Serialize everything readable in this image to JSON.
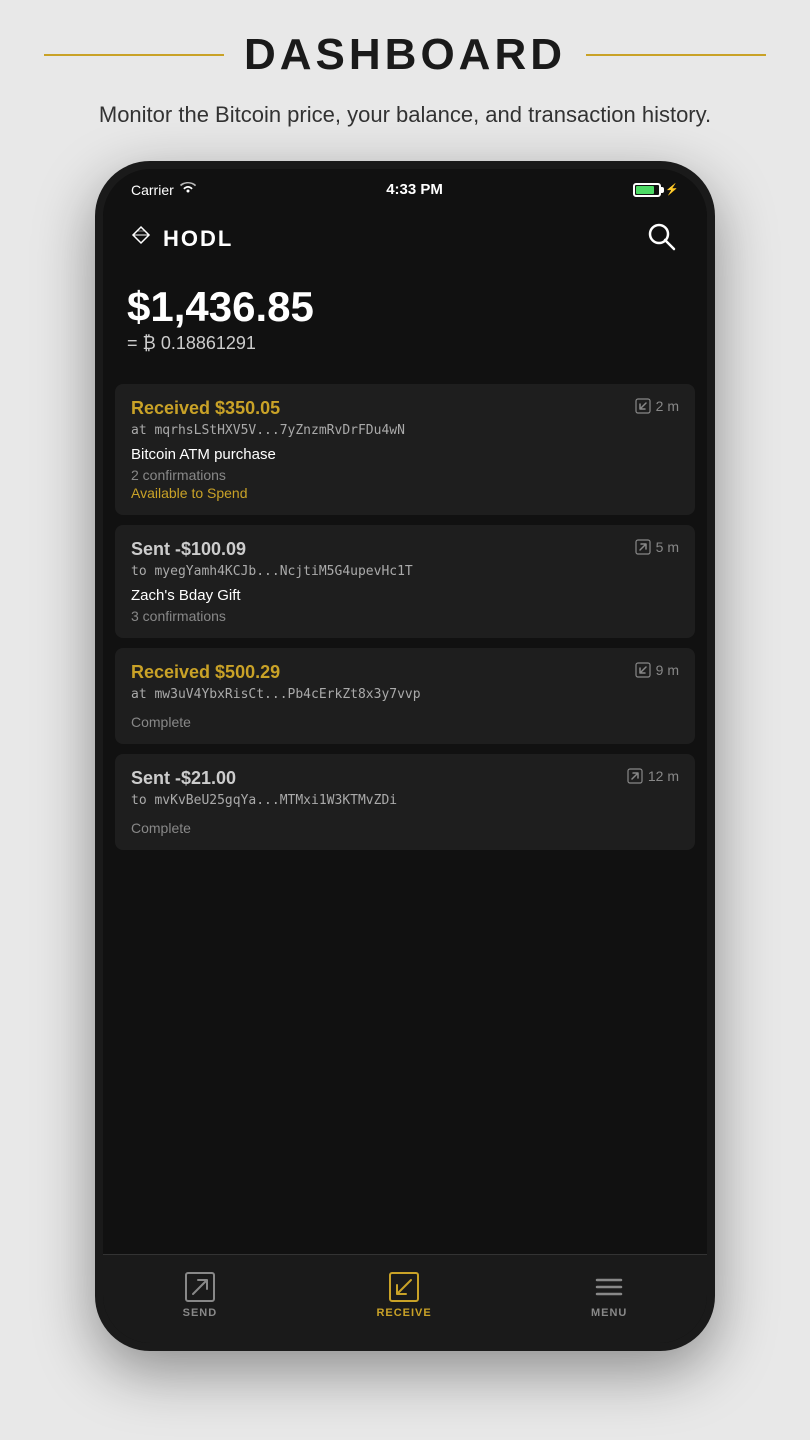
{
  "page": {
    "title": "DASHBOARD",
    "subtitle": "Monitor the Bitcoin price, your balance, and transaction history."
  },
  "status_bar": {
    "carrier": "Carrier",
    "wifi": "wifi",
    "time": "4:33 PM",
    "battery": "80"
  },
  "app": {
    "logo_text": "HODL",
    "balance_usd": "$1,436.85",
    "balance_eq": "= ₿ 0.18861291"
  },
  "transactions": [
    {
      "amount": "Received $350.05",
      "type": "received",
      "address": "at mqrhsLStHXV5V...7yZnzmRvDrFDu4wN",
      "time": "2 m",
      "label": "Bitcoin ATM purchase",
      "confirmations": "2 confirmations",
      "status": "Available to Spend",
      "status_type": "available"
    },
    {
      "amount": "Sent -$100.09",
      "type": "sent",
      "address": "to myegYamh4KCJb...NcjtiM5G4upevHc1T",
      "time": "5 m",
      "label": "Zach's Bday Gift",
      "confirmations": "3 confirmations",
      "status": "",
      "status_type": "none"
    },
    {
      "amount": "Received $500.29",
      "type": "received",
      "address": "at mw3uV4YbxRisCt...Pb4cErkZt8x3y7vvp",
      "time": "9 m",
      "label": "",
      "confirmations": "",
      "status": "Complete",
      "status_type": "complete"
    },
    {
      "amount": "Sent -$21.00",
      "type": "sent",
      "address": "to mvKvBeU25gqYa...MTMxi1W3KTMvZDi",
      "time": "12 m",
      "label": "",
      "confirmations": "",
      "status": "Complete",
      "status_type": "complete"
    }
  ],
  "nav": {
    "send_label": "SEND",
    "receive_label": "RECEIVE",
    "menu_label": "MENU"
  }
}
